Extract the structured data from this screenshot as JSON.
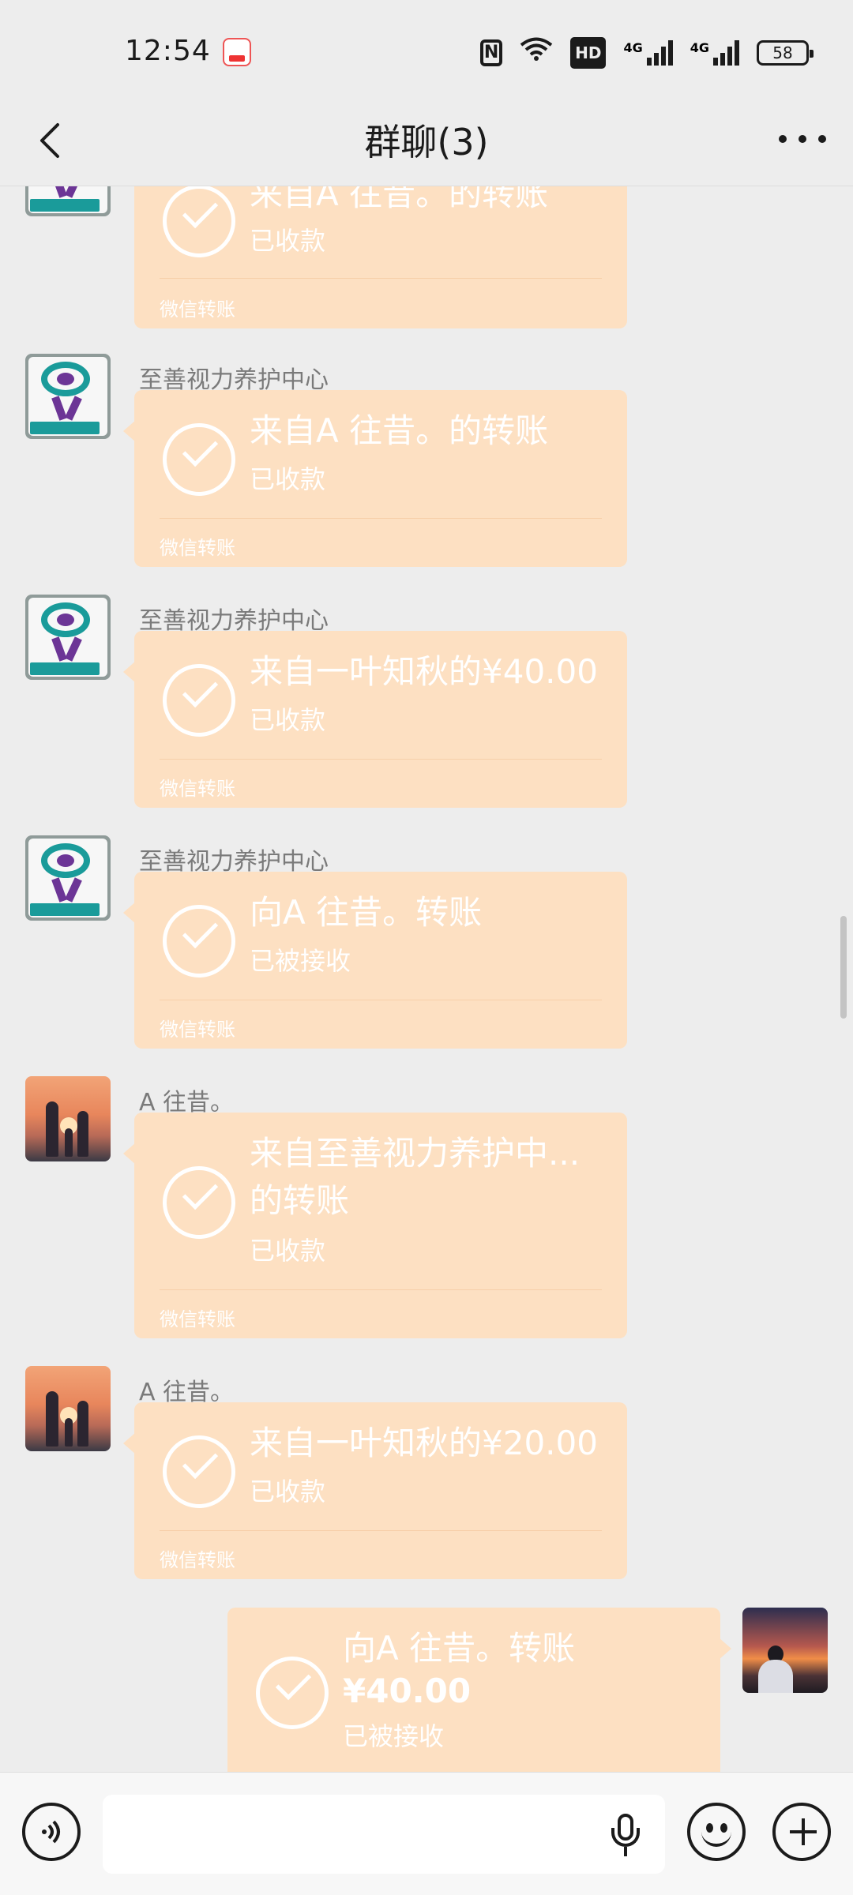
{
  "status_bar": {
    "time": "12:54",
    "network_label_1": "4G",
    "network_label_2": "4G",
    "hd_label": "HD",
    "battery": "58"
  },
  "header": {
    "title": "群聊(3)"
  },
  "messages": [
    {
      "sender": "",
      "title": "来自A   往昔。的转账",
      "status": "已收款",
      "footer": "微信转账",
      "avatar": "organization-logo"
    },
    {
      "sender": "至善视力养护中心",
      "title": "来自A   往昔。的转账",
      "status": "已收款",
      "footer": "微信转账",
      "avatar": "organization-logo"
    },
    {
      "sender": "至善视力养护中心",
      "title": "来自一叶知秋的¥40.00",
      "status": "已收款",
      "footer": "微信转账",
      "avatar": "organization-logo"
    },
    {
      "sender": "至善视力养护中心",
      "title": "向A   往昔。转账",
      "status": "已被接收",
      "footer": "微信转账",
      "avatar": "organization-logo"
    },
    {
      "sender": "A   往昔。",
      "title": "来自至善视力养护中...的转账",
      "status": "已收款",
      "footer": "微信转账",
      "avatar": "family-sunset-photo"
    },
    {
      "sender": "A   往昔。",
      "title": "来自一叶知秋的¥20.00",
      "status": "已收款",
      "footer": "微信转账",
      "avatar": "family-sunset-photo"
    },
    {
      "sender": "",
      "title": "向A   往昔。转账",
      "amount": "¥40.00",
      "status": "已被接收",
      "avatar": "self-sunset-photo"
    }
  ],
  "input_bar": {
    "placeholder": "",
    "icons": [
      "voice-icon",
      "microphone-icon",
      "emoji-icon",
      "plus-icon"
    ]
  },
  "colors": {
    "background": "#ededed",
    "bubble": "#fde0c2",
    "bubble_text": "#ffffff",
    "sender_text": "#7a7a7a"
  }
}
